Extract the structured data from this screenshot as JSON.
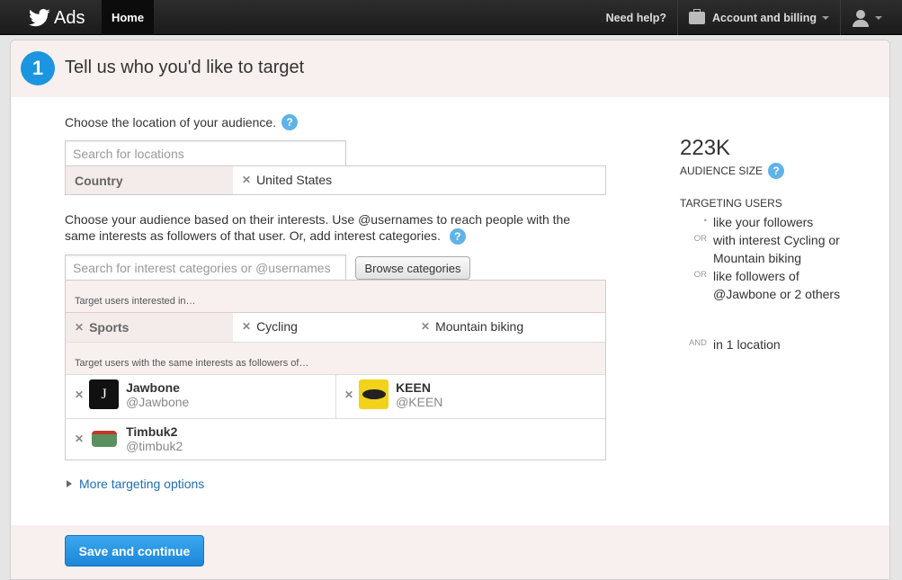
{
  "topbar": {
    "brand": "Ads",
    "home": "Home",
    "help": "Need help?",
    "account": "Account and billing"
  },
  "step": {
    "number": "1",
    "title": "Tell us who you'd like to target"
  },
  "location": {
    "question": "Choose the location of your audience.",
    "placeholder": "Search for locations",
    "label": "Country",
    "selected": "United States"
  },
  "interests": {
    "question": "Choose your audience based on their interests. Use @usernames to reach people with the same interests as followers of that user. Or, add interest categories.",
    "placeholder": "Search for interest categories or @usernames",
    "browse_button": "Browse categories",
    "section_interests": "Target users interested in…",
    "category": "Sports",
    "chips": [
      "Cycling",
      "Mountain biking"
    ],
    "section_followers": "Target users with the same interests as followers of…",
    "accounts": [
      {
        "name": "Jawbone",
        "handle": "@Jawbone",
        "avatar_color": "#111111"
      },
      {
        "name": "KEEN",
        "handle": "@KEEN",
        "avatar_color": "#f2d21b"
      },
      {
        "name": "Timbuk2",
        "handle": "@timbuk2",
        "avatar_color": "#5a8f5e"
      }
    ]
  },
  "more_options": "More targeting options",
  "save_button": "Save and continue",
  "summary": {
    "audience_size": "223K",
    "audience_label": "AUDIENCE SIZE",
    "targeting_head": "TARGETING USERS",
    "criteria": [
      {
        "conj": "•",
        "text": "like your followers"
      },
      {
        "conj": "OR",
        "text": "with interest Cycling or Mountain biking"
      },
      {
        "conj": "OR",
        "text": "like followers of @Jawbone or 2 others"
      },
      {
        "conj": "AND",
        "text": "in 1 location"
      }
    ]
  },
  "colors": {
    "accent": "#1b95e0",
    "header_bg": "#f8f0ef",
    "link": "#1f6eb5"
  },
  "icons": [
    "twitter-bird-icon",
    "briefcase-icon",
    "user-icon",
    "help-icon",
    "remove-icon",
    "expand-triangle-icon"
  ]
}
